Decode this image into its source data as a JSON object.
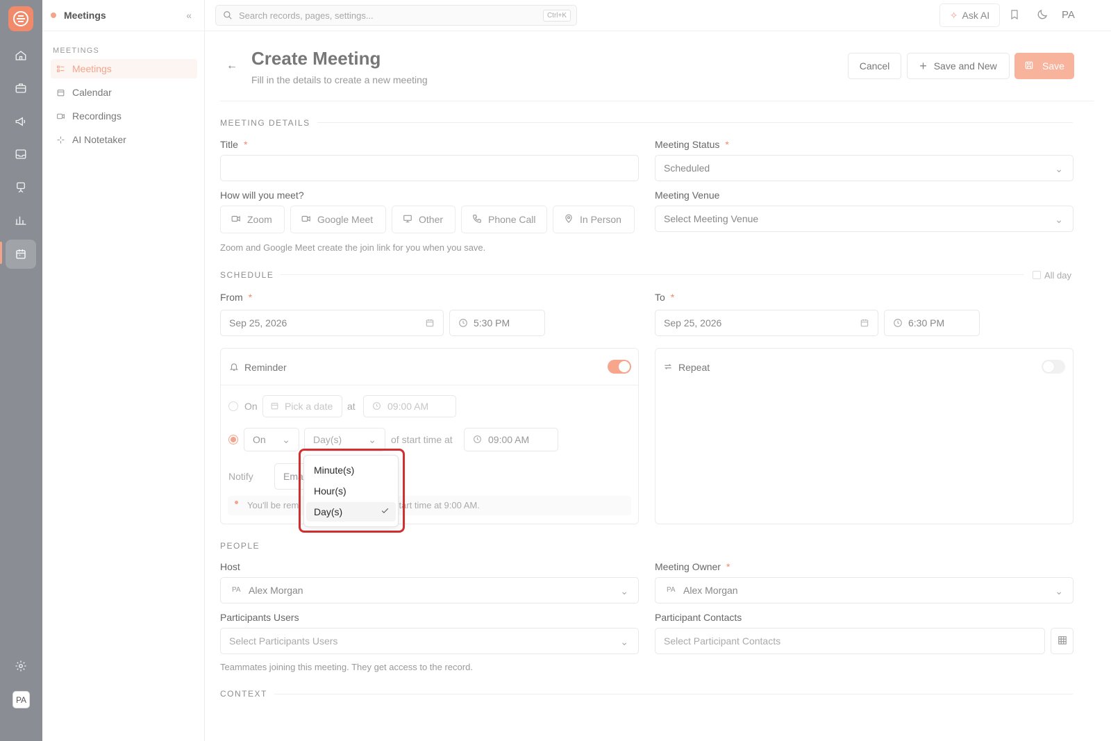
{
  "rail": {
    "avatar": "PA",
    "icons": [
      "home-icon",
      "briefcase-icon",
      "megaphone-icon",
      "inbox-icon",
      "presentation-icon",
      "bar-chart-icon",
      "calendar-icon",
      "settings-icon"
    ]
  },
  "sidebar": {
    "title": "Meetings",
    "section": "MEETINGS",
    "items": [
      {
        "label": "Meetings",
        "icon": "list-icon",
        "active": true
      },
      {
        "label": "Calendar",
        "icon": "calendar-icon",
        "active": false
      },
      {
        "label": "Recordings",
        "icon": "video-icon",
        "active": false
      },
      {
        "label": "AI Notetaker",
        "icon": "sparkle-icon",
        "active": false
      }
    ]
  },
  "topbar": {
    "search_placeholder": "Search records, pages, settings...",
    "search_shortcut": "Ctrl+K",
    "ask_ai": "Ask AI",
    "user": "PA"
  },
  "page": {
    "title": "Create Meeting",
    "subtitle": "Fill in the details to create a new meeting",
    "cancel": "Cancel",
    "save_and_new": "Save and New",
    "save": "Save"
  },
  "details": {
    "section": "MEETING DETAILS",
    "title_label": "Title",
    "status_label": "Meeting Status",
    "status_value": "Scheduled",
    "how_label": "How will you meet?",
    "venue_label": "Meeting Venue",
    "venue_placeholder": "Select Meeting Venue",
    "methods": [
      "Zoom",
      "Google Meet",
      "Other",
      "Phone Call",
      "In Person"
    ],
    "help": "Zoom and Google Meet create the join link for you when you save."
  },
  "schedule": {
    "section": "SCHEDULE",
    "all_day": "All day",
    "from_label": "From",
    "from_date": "Sep 25, 2026",
    "from_time": "5:30 PM",
    "to_label": "To",
    "to_date": "Sep 25, 2026",
    "to_time": "6:30 PM"
  },
  "reminder": {
    "title": "Reminder",
    "enabled": true,
    "row1_on": "On",
    "row1_date_placeholder": "Pick a date",
    "row1_at": "at",
    "row1_time": "09:00 AM",
    "row2_on": "On",
    "row2_unit": "Day(s)",
    "row2_text": "of start time at",
    "row2_time": "09:00 AM",
    "notify_label": "Notify",
    "notify_value": "Emai",
    "info_prefix": "You'll be remi",
    "info_suffix": "start time at 9:00 AM."
  },
  "repeat": {
    "title": "Repeat",
    "enabled": false
  },
  "unit_dropdown": {
    "options": [
      "Minute(s)",
      "Hour(s)",
      "Day(s)"
    ],
    "selected": "Day(s)"
  },
  "people": {
    "section": "PEOPLE",
    "host_label": "Host",
    "host_initials": "PA",
    "host_value": "Alex Morgan",
    "owner_label": "Meeting Owner",
    "owner_initials": "PA",
    "owner_value": "Alex Morgan",
    "participants_label": "Participants Users",
    "participants_placeholder": "Select Participants Users",
    "contacts_label": "Participant Contacts",
    "contacts_placeholder": "Select Participant Contacts",
    "help": "Teammates joining this meeting. They get access to the record."
  },
  "context": {
    "section": "CONTEXT"
  },
  "colors": {
    "accent": "#f3a58c",
    "rail": "#8a8d93",
    "highlight": "#d32f2f"
  }
}
